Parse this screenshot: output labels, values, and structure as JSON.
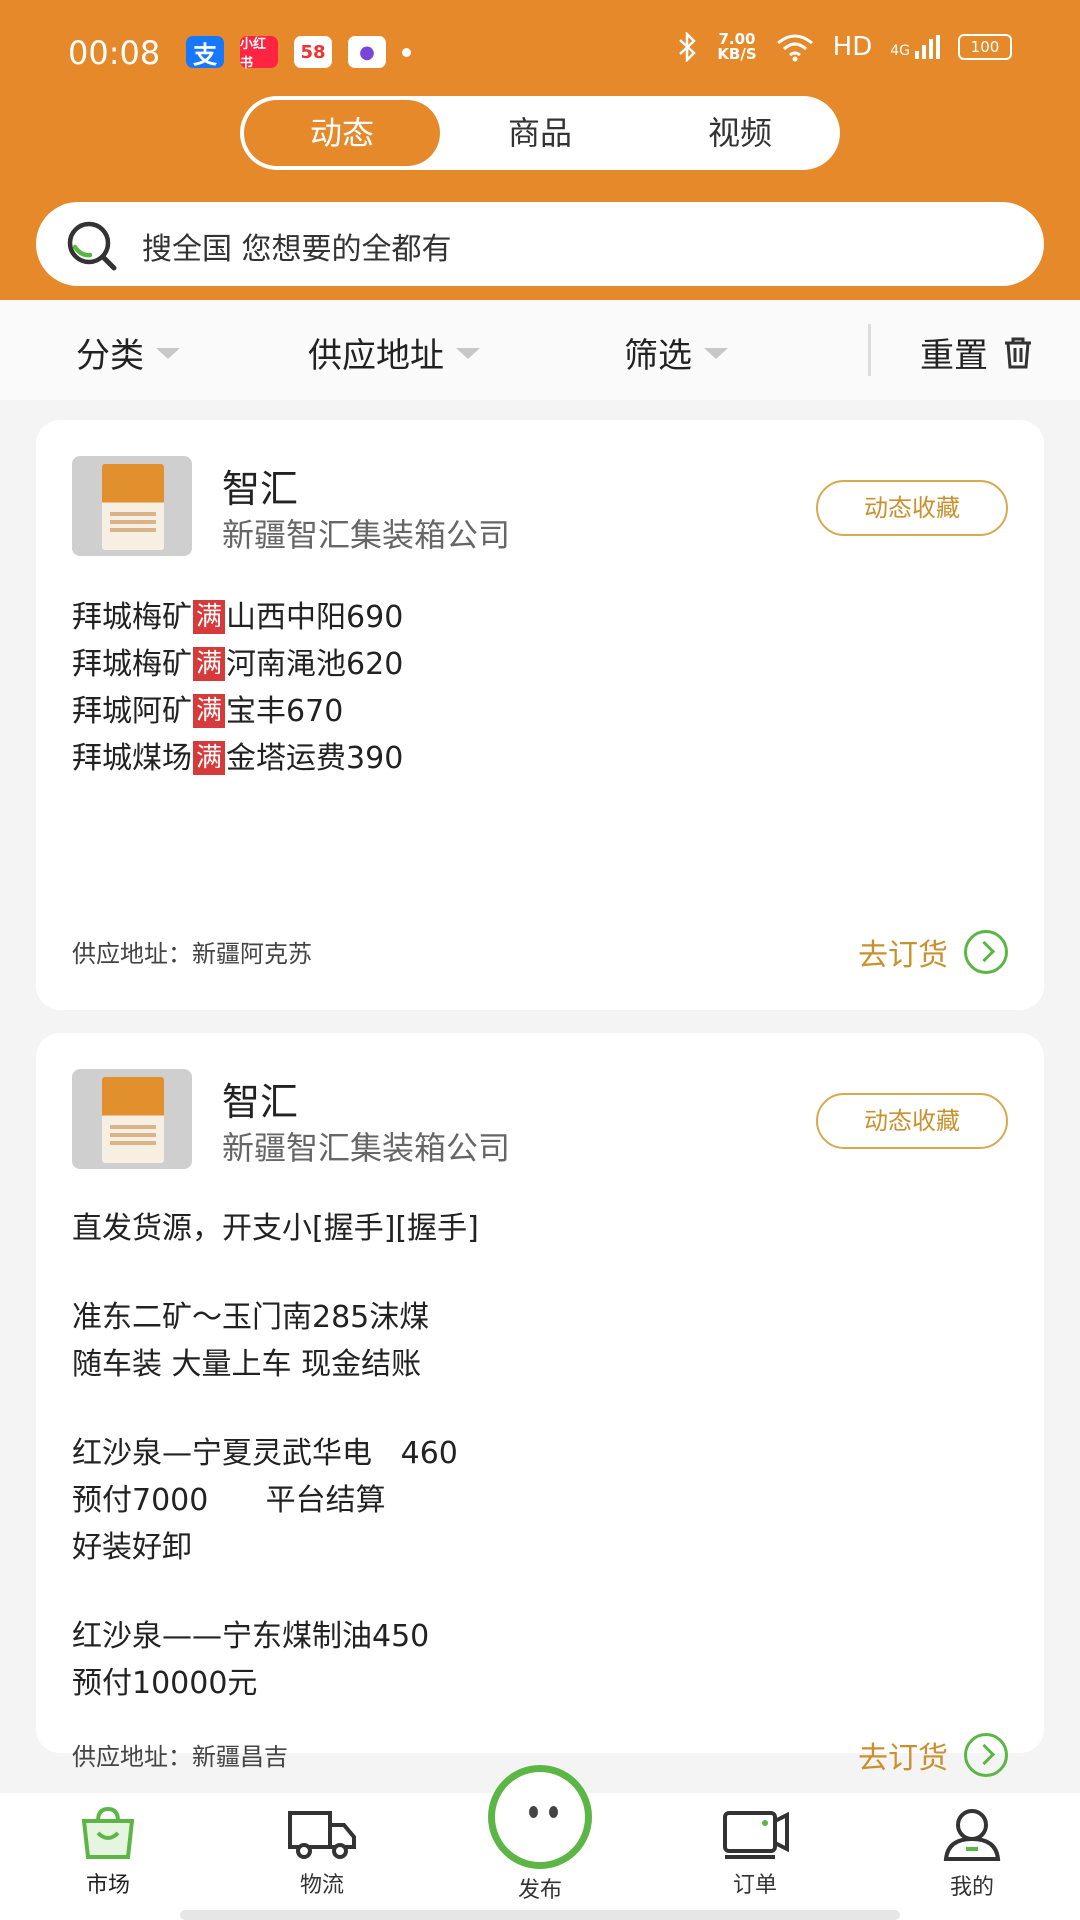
{
  "status_bar": {
    "time": "00:08",
    "app_icons": [
      "支",
      "小红书",
      "58",
      "●"
    ],
    "network_speed_value": "7.00",
    "network_speed_unit": "KB/S",
    "hd": "HD",
    "network": "4G",
    "battery": "100"
  },
  "tabs": [
    {
      "label": "动态",
      "active": true
    },
    {
      "label": "商品",
      "active": false
    },
    {
      "label": "视频",
      "active": false
    }
  ],
  "search": {
    "placeholder": "搜全国 您想要的全都有"
  },
  "filters": {
    "category": "分类",
    "supply_address": "供应地址",
    "filter": "筛选",
    "reset": "重置"
  },
  "posts": [
    {
      "seller": "智汇",
      "company": "新疆智汇集装箱公司",
      "favorite_label": "动态收藏",
      "lines": [
        {
          "a": "拜城梅矿",
          "tag": "满",
          "b": "山西中阳690"
        },
        {
          "a": "拜城梅矿",
          "tag": "满",
          "b": "河南渑池620"
        },
        {
          "a": "拜城阿矿",
          "tag": "满",
          "b": "宝丰670"
        },
        {
          "a": "拜城煤场",
          "tag": "满",
          "b": "金塔运费390"
        }
      ],
      "address": "供应地址：新疆阿克苏",
      "order_label": "去订货"
    },
    {
      "seller": "智汇",
      "company": "新疆智汇集装箱公司",
      "favorite_label": "动态收藏",
      "lines": [
        "直发货源，开支小[握手][握手]",
        "准东二矿～玉门南285沫煤",
        "随车装 大量上车 现金结账",
        "红沙泉—宁夏灵武华电   460",
        "预付7000      平台结算",
        "好装好卸",
        "红沙泉——宁东煤制油450",
        "预付10000元"
      ],
      "address": "供应地址：新疆昌吉",
      "order_label": "去订货"
    }
  ],
  "bottom_nav": {
    "market": "市场",
    "logistics": "物流",
    "publish": "发布",
    "orders": "订单",
    "mine": "我的"
  },
  "colors": {
    "brand_orange": "#e5892a",
    "accent_green": "#5cb645",
    "gold": "#c9912d",
    "tag_red": "#d63a3a"
  }
}
